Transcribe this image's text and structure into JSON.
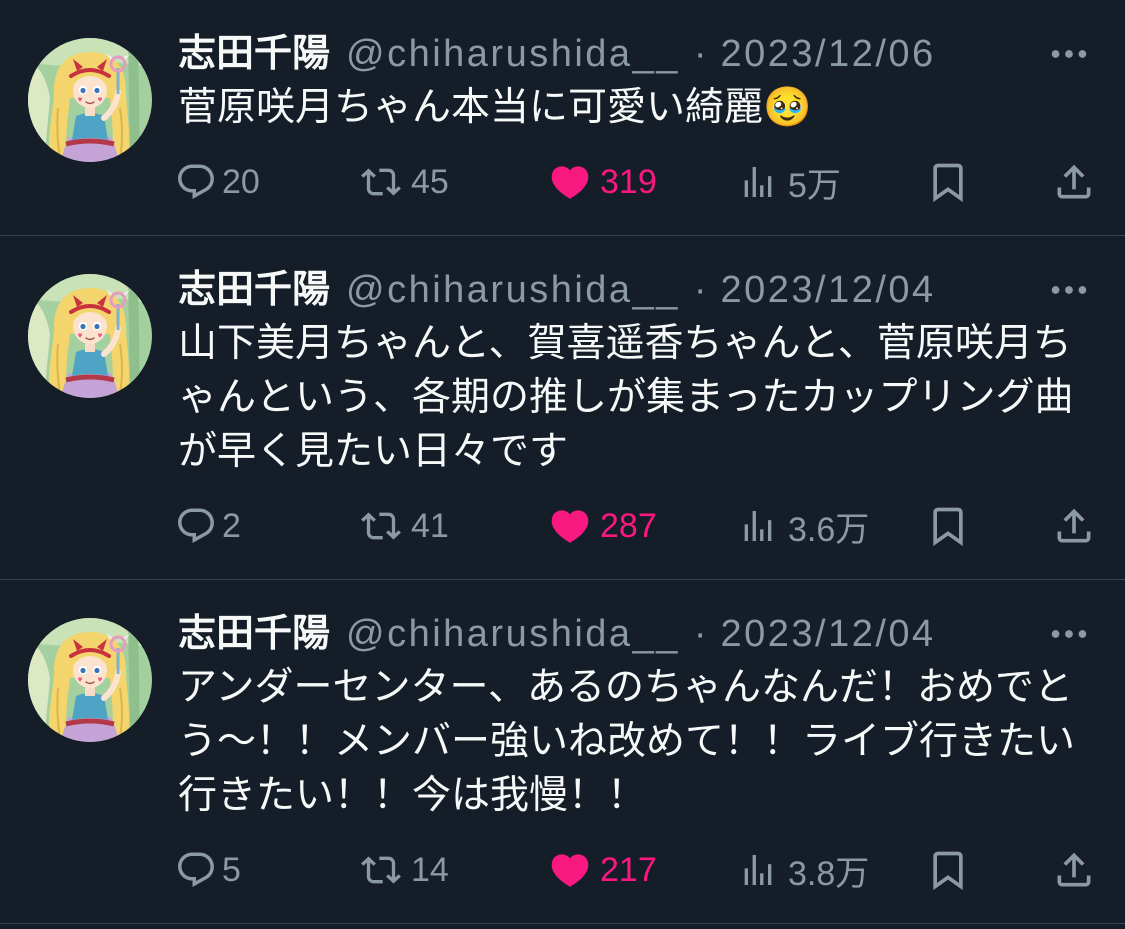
{
  "theme": {
    "background": "#151d28",
    "primary_text": "#f7f9f9",
    "secondary_text": "#8b98a5",
    "divider": "#38444d",
    "like_color": "#f91880"
  },
  "icons": {
    "more": "more-horizontal-icon",
    "reply": "reply-icon",
    "retweet": "retweet-icon",
    "like": "heart-filled-icon",
    "views": "views-bar-chart-icon",
    "bookmark": "bookmark-icon",
    "share": "share-icon"
  },
  "tweets": [
    {
      "author_name": "志田千陽",
      "handle": "@chiharushida__",
      "separator": "·",
      "date": "2023/12/06",
      "text_lines": [
        "菅原咲月ちゃん本当に可愛い綺麗🥹"
      ],
      "replies": "20",
      "retweets": "45",
      "likes": "319",
      "liked": true,
      "views": "5万"
    },
    {
      "author_name": "志田千陽",
      "handle": "@chiharushida__",
      "separator": "·",
      "date": "2023/12/04",
      "text_lines": [
        "山下美月ちゃんと、賀喜遥香ちゃんと、菅原咲月ち",
        "ゃんという、各期の推しが集まったカップリング曲",
        "が早く見たい日々です"
      ],
      "replies": "2",
      "retweets": "41",
      "likes": "287",
      "liked": true,
      "views": "3.6万"
    },
    {
      "author_name": "志田千陽",
      "handle": "@chiharushida__",
      "separator": "·",
      "date": "2023/12/04",
      "text_lines": [
        "アンダーセンター、あるのちゃんなんだ！おめでと",
        "う〜！！メンバー強いね改めて！！ライブ行きたい",
        "行きたい！！今は我慢！！"
      ],
      "replies": "5",
      "retweets": "14",
      "likes": "217",
      "liked": true,
      "views": "3.8万"
    }
  ]
}
